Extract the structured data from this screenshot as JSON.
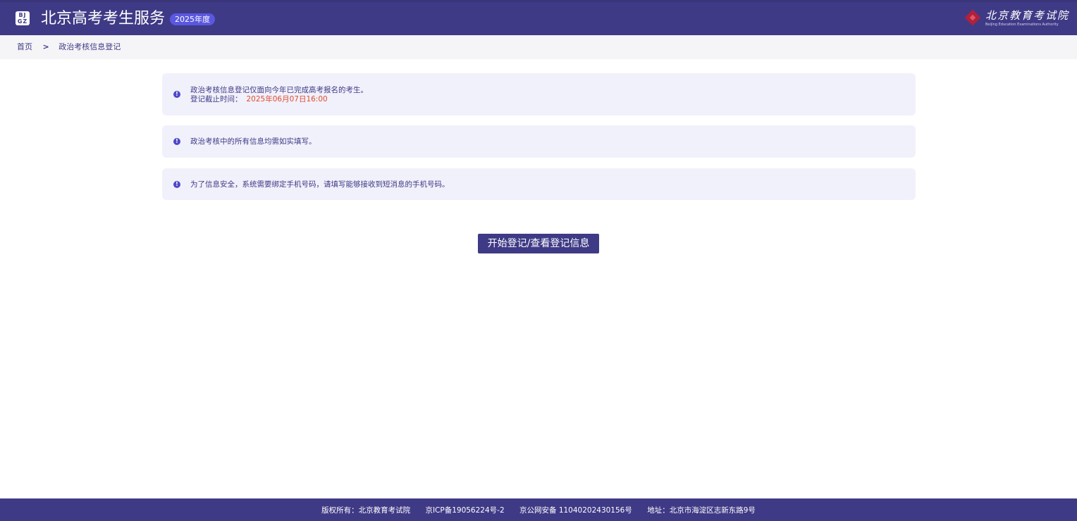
{
  "header": {
    "logo_text_top": "BJ",
    "logo_text_bottom": "GZ",
    "title": "北京高考考生服务",
    "year_badge": "2025年度",
    "org_name": "北京教育考试院",
    "org_subtitle": "Beijing Education Examinations Authority"
  },
  "breadcrumb": {
    "home": "首页",
    "separator": ">",
    "current": "政治考核信息登记"
  },
  "notices": [
    {
      "line1": "政治考核信息登记仅面向今年已完成高考报名的考生。",
      "deadline_label": "登记截止时间：",
      "deadline_value": "2025年06月07日16:00"
    },
    {
      "text": "政治考核中的所有信息均需如实填写。"
    },
    {
      "text": "为了信息安全，系统需要绑定手机号码，请填写能够接收到短消息的手机号码。"
    }
  ],
  "notice_icon_glyph": "!",
  "start_button_label": "开始登记/查看登记信息",
  "footer": {
    "copyright": "版权所有：北京教育考试院",
    "icp": "京ICP备19056224号-2",
    "police": "京公网安备 11040202430156号",
    "address": "地址：北京市海淀区志新东路9号"
  },
  "colors": {
    "primary": "#3f3a86",
    "badge": "#5a58e0",
    "notice_bg": "#f1f1fb",
    "deadline": "#e04a2f",
    "org_red": "#b0213a"
  }
}
